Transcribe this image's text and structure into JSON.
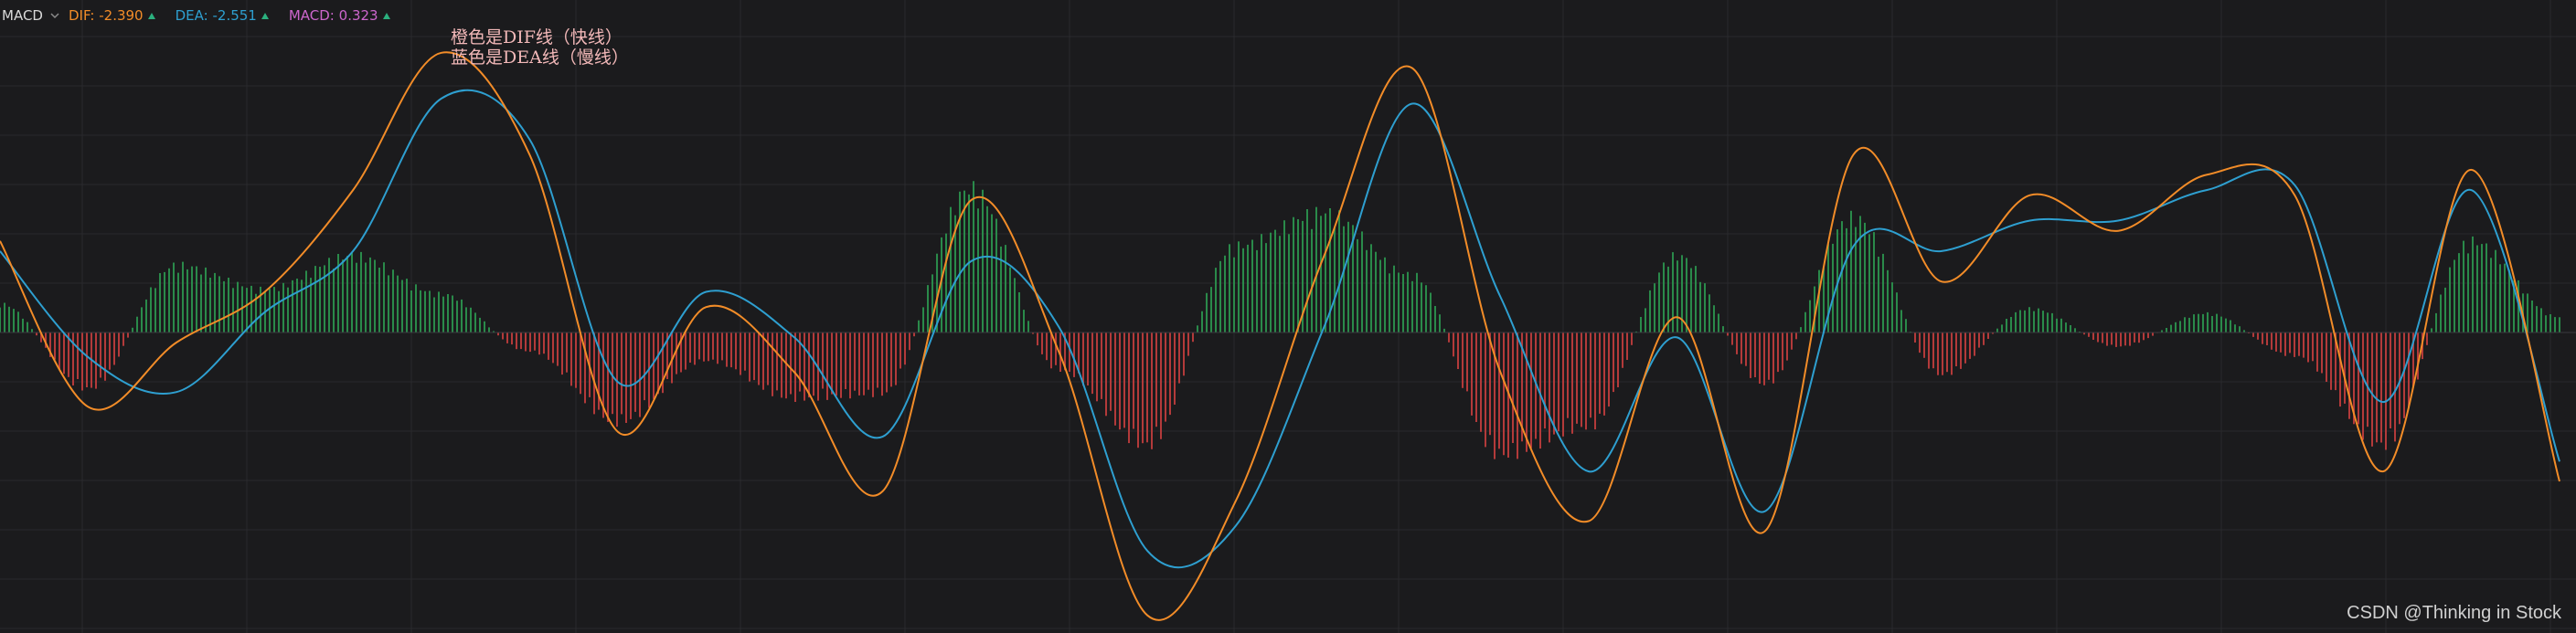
{
  "legend": {
    "indicator": "MACD",
    "dif_label": "DIF:",
    "dif_value": "-2.390",
    "dea_label": "DEA:",
    "dea_value": "-2.551",
    "macd_label": "MACD:",
    "macd_value": "0.323"
  },
  "annotation": {
    "line1": "橙色是DIF线（快线）",
    "line2": "蓝色是DEA线（慢线）"
  },
  "watermark": "CSDN @Thinking in Stock",
  "colors": {
    "background": "#1b1b1d",
    "grid": "#2a2a2d",
    "dif": "#f28c28",
    "dea": "#2e9fd0",
    "macd_label": "#cc66cc",
    "hist_up": "#2a8a4a",
    "hist_down": "#b33a3a",
    "annotation": "#f2b8b8",
    "indicator_name": "#d9d9d9"
  },
  "chart_data": {
    "type": "line",
    "x": [
      0,
      10,
      20,
      30,
      40,
      50,
      60,
      70,
      80,
      90,
      100,
      110,
      120,
      130,
      140,
      150,
      160,
      170,
      180,
      190,
      200,
      210,
      220,
      230,
      240,
      250,
      260,
      270,
      280,
      290
    ],
    "ylim": [
      -6,
      6
    ],
    "zero_line": 0,
    "grid": true,
    "series": [
      {
        "name": "DIF",
        "values": [
          1.8,
          -1.5,
          -0.2,
          0.8,
          2.8,
          5.5,
          3.5,
          -2.0,
          0.5,
          -0.8,
          -3.2,
          2.6,
          -0.4,
          -5.7,
          -3.4,
          1.5,
          5.2,
          -0.8,
          -3.8,
          0.3,
          -4.0,
          3.5,
          1.0,
          2.7,
          2.0,
          3.1,
          2.7,
          -2.8,
          3.2,
          -3.0
        ]
      },
      {
        "name": "DEA",
        "values": [
          1.6,
          -0.5,
          -1.2,
          0.4,
          1.6,
          4.6,
          3.8,
          -1.0,
          0.8,
          -0.1,
          -2.1,
          1.4,
          0.1,
          -4.4,
          -3.9,
          0.1,
          4.5,
          0.7,
          -2.8,
          -0.1,
          -3.6,
          1.7,
          1.6,
          2.2,
          2.2,
          2.8,
          2.9,
          -1.4,
          2.8,
          -2.6
        ]
      },
      {
        "name": "MACD",
        "type": "bar",
        "values": [
          0.6,
          -1.2,
          1.4,
          0.9,
          1.6,
          0.8,
          -0.4,
          -1.9,
          -0.6,
          -1.4,
          -1.3,
          3.0,
          -0.8,
          -2.4,
          1.8,
          2.5,
          1.2,
          -2.6,
          -2.0,
          1.6,
          -1.1,
          2.4,
          -0.9,
          0.5,
          -0.3,
          0.4,
          -0.5,
          -2.4,
          1.9,
          0.32
        ]
      }
    ]
  }
}
